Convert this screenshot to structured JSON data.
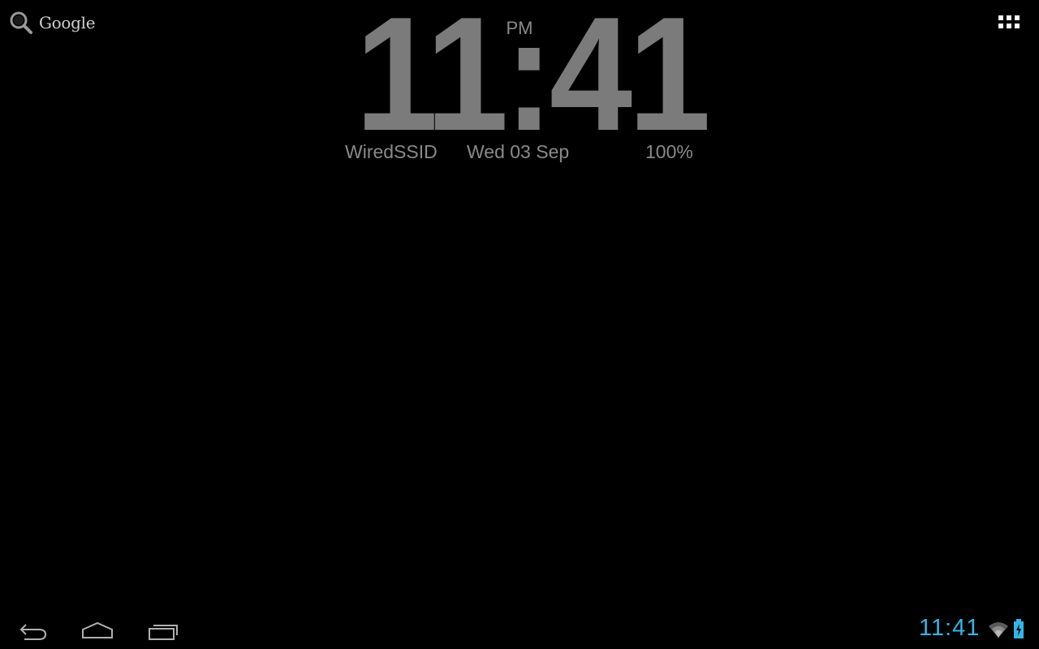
{
  "search": {
    "label": "Google",
    "icon": "search-icon"
  },
  "launcher": {
    "all_apps_icon": "grid-icon"
  },
  "clock": {
    "time": "11:41",
    "ampm": "PM",
    "ssid": "WiredSSID",
    "date": "Wed 03 Sep",
    "battery": "100%"
  },
  "navbar": {
    "back_icon": "back-arrow-icon",
    "home_icon": "home-icon",
    "recents_icon": "recent-apps-icon"
  },
  "status": {
    "time": "11:41",
    "wifi_icon": "wifi-icon",
    "battery_icon": "battery-charging-icon",
    "accent_color": "#33b5e5"
  }
}
